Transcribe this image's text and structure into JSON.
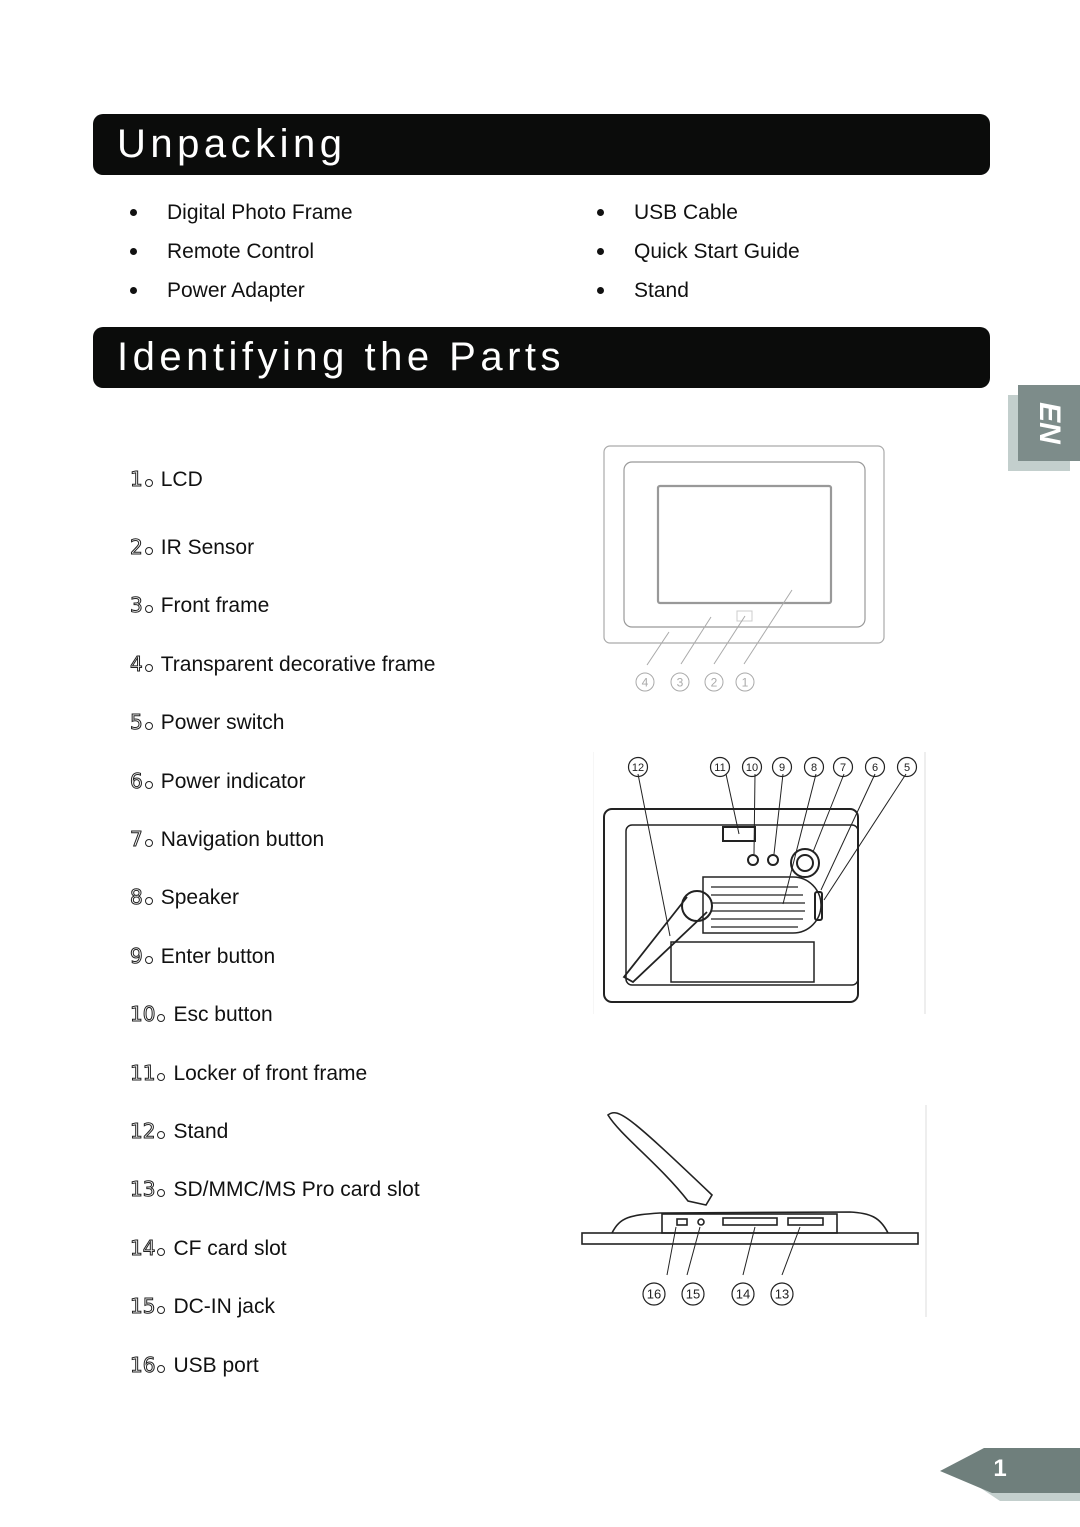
{
  "sections": {
    "unpacking": {
      "title": "Unpacking",
      "items_left": [
        "Digital Photo Frame",
        "Remote Control",
        "Power Adapter"
      ],
      "items_right": [
        "USB Cable",
        "Quick Start Guide",
        "Stand"
      ]
    },
    "parts": {
      "title": "Identifying the Parts",
      "items": [
        {
          "num": "1",
          "label": "LCD"
        },
        {
          "num": "2",
          "label": "IR Sensor"
        },
        {
          "num": "3",
          "label": "Front frame"
        },
        {
          "num": "4",
          "label": "Transparent decorative frame"
        },
        {
          "num": "5",
          "label": "Power switch"
        },
        {
          "num": "6",
          "label": "Power indicator"
        },
        {
          "num": "7",
          "label": "Navigation button"
        },
        {
          "num": "8",
          "label": "Speaker"
        },
        {
          "num": "9",
          "label": "Enter button"
        },
        {
          "num": "10",
          "label": "Esc button"
        },
        {
          "num": "11",
          "label": "Locker of front frame"
        },
        {
          "num": "12",
          "label": "Stand"
        },
        {
          "num": "13",
          "label": "SD/MMC/MS Pro card slot"
        },
        {
          "num": "14",
          "label": "CF card slot"
        },
        {
          "num": "15",
          "label": "DC-IN jack"
        },
        {
          "num": "16",
          "label": "USB port"
        }
      ]
    }
  },
  "figures": {
    "front_view_callouts": [
      "4",
      "3",
      "2",
      "1"
    ],
    "back_view_callouts": [
      "12",
      "11",
      "10",
      "9",
      "8",
      "7",
      "6",
      "5"
    ],
    "side_view_callouts": [
      "16",
      "15",
      "14",
      "13"
    ]
  },
  "side_tab": {
    "label": "EN",
    "color_front": "#7d8c8a",
    "color_back": "#c3cfcd"
  },
  "page_number": "1"
}
